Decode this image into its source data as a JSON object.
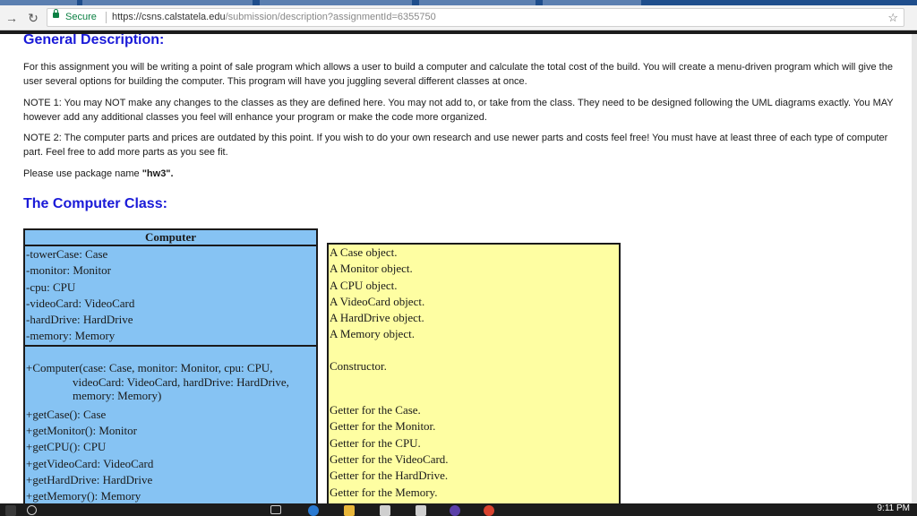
{
  "browser": {
    "secure_label": "Secure",
    "url_host": "https://csns.calstatela.edu",
    "url_path": "/submission/description?assignmentId=6355750",
    "star_glyph": "☆"
  },
  "page": {
    "heading_general": "General Description:",
    "para1": "For this assignment you will be writing a point of sale program which allows a user to build a computer and calculate the total cost of the build.  You will create a menu-driven program which will give the user several options for building the computer.  This program will have you juggling several different classes at once.",
    "para2": "NOTE 1: You may NOT make any changes to the classes as they are defined here.  You may not add to, or take from the class.  They need to be designed following the UML diagrams exactly.  You MAY however add any additional classes you feel will enhance your program or make the code more organized.",
    "para3": "NOTE 2: The computer parts and prices are outdated by this point.  If you wish to do your own research and use newer parts and costs feel free!  You must have at least three of each type of computer part.  Feel free to add more parts as you see fit.",
    "para4_prefix": "Please use package name ",
    "para4_package": "\"hw3\".",
    "heading_computer": "The Computer Class:"
  },
  "uml": {
    "class_name": "Computer",
    "attributes": [
      "-towerCase: Case",
      "-monitor: Monitor",
      "-cpu: CPU",
      "-videoCard: VideoCard",
      "-hardDrive: HardDrive",
      "-memory: Memory"
    ],
    "attribute_notes": [
      "A Case object.",
      "A Monitor object.",
      "A CPU object.",
      "A VideoCard object.",
      "A HardDrive object.",
      "A Memory object."
    ],
    "constructor_line1": "+Computer(case: Case, monitor: Monitor, cpu: CPU,",
    "constructor_line2": "videoCard: VideoCard, hardDrive: HardDrive,",
    "constructor_line3": "memory: Memory)",
    "constructor_note": "Constructor.",
    "methods": [
      "+getCase(): Case",
      "+getMonitor(): Monitor",
      "+getCPU(): CPU",
      "+getVideoCard: VideoCard",
      "+getHardDrive: HardDrive",
      "+getMemory(): Memory"
    ],
    "method_notes": [
      "Getter for the Case.",
      "Getter for the Monitor.",
      "Getter for the CPU.",
      "Getter for the VideoCard.",
      "Getter for the HardDrive.",
      "Getter for the Memory."
    ]
  },
  "taskbar": {
    "clock": "9:11 PM"
  },
  "colors": {
    "heading": "#1a1ad8",
    "uml_left_bg": "#86c3f3",
    "uml_right_bg": "#fefea2",
    "secure_green": "#0b8043"
  }
}
